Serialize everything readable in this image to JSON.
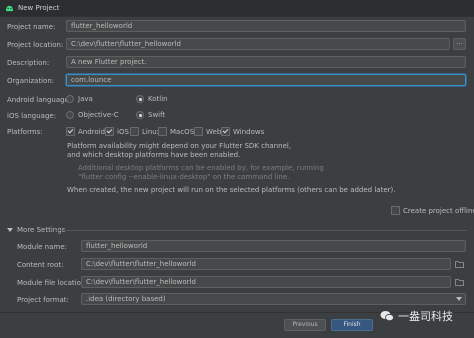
{
  "window": {
    "title": "New Project"
  },
  "form": {
    "project_name": {
      "label": "Project name:",
      "value": "flutter_helloworld"
    },
    "project_location": {
      "label": "Project location:",
      "value": "C:\\dev\\flutter\\flutter_helloworld",
      "browse": "..."
    },
    "description": {
      "label": "Description:",
      "value": "A new Flutter project."
    },
    "organization": {
      "label": "Organization:",
      "value": "com.lounce"
    },
    "android_language": {
      "label": "Android language:",
      "options": [
        "Java",
        "Kotlin"
      ],
      "selected": "Kotlin"
    },
    "ios_language": {
      "label": "iOS language:",
      "options": [
        "Objective-C",
        "Swift"
      ],
      "selected": "Swift"
    },
    "platforms": {
      "label": "Platforms:",
      "items": [
        {
          "name": "Android",
          "checked": true
        },
        {
          "name": "iOS",
          "checked": true
        },
        {
          "name": "Linux",
          "checked": false
        },
        {
          "name": "MacOS",
          "checked": false
        },
        {
          "name": "Web",
          "checked": false
        },
        {
          "name": "Windows",
          "checked": true
        }
      ]
    },
    "info": {
      "line1": "Platform availability might depend on your Flutter SDK channel,",
      "line2": "and which desktop platforms have been enabled.",
      "line3": "Additional desktop platforms can be enabled by, for example, running",
      "line4": "\"flutter config --enable-linux-desktop\" on the command line.",
      "line5": "When created, the new project will run on the selected platforms (others can be added later)."
    },
    "create_offline": {
      "label": "Create project offline",
      "checked": false
    }
  },
  "more_settings": {
    "title": "More Settings",
    "module_name": {
      "label": "Module name:",
      "value": "flutter_helloworld"
    },
    "content_root": {
      "label": "Content root:",
      "value": "C:\\dev\\flutter\\flutter_helloworld"
    },
    "module_file_location": {
      "label": "Module file location:",
      "value": "C:\\dev\\flutter\\flutter_helloworld"
    },
    "project_format": {
      "label": "Project format:",
      "value": ".idea (directory based)"
    }
  },
  "buttons": {
    "previous": "Previous",
    "finish": "Finish"
  },
  "watermark": {
    "text": "一盎司科技"
  },
  "colors": {
    "accent": "#3592c4",
    "primary_button": "#365880",
    "background": "#3c3f41"
  }
}
